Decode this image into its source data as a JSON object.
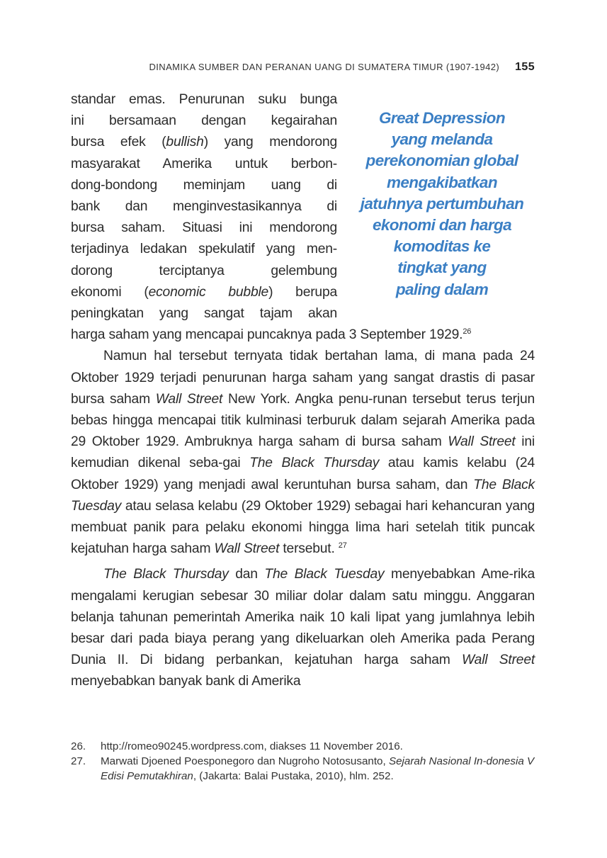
{
  "header": {
    "running_title": "DINAMIKA SUMBER DAN PERANAN UANG DI SUMATERA TIMUR (1907-1942)",
    "page_number": "155"
  },
  "pullquote": [
    "Great Depression",
    "yang melanda",
    "perekonomian global",
    "mengakibatkan",
    "jatuhnya pertumbuhan",
    "ekonomi dan harga",
    "komoditas ke",
    "tingkat yang",
    "paling dalam"
  ],
  "para1": {
    "l1": "standar emas. Penurunan suku bunga",
    "l2": "ini bersamaan dengan kegairahan",
    "l3a": "bursa efek (",
    "l3b": "bullish",
    "l3c": ") yang mendorong",
    "l4": "masyarakat Amerika untuk berbon-",
    "l5": "dong-bondong meminjam uang di",
    "l6": "bank dan menginvestasikannya di",
    "l7": "bursa saham. Situasi ini mendorong",
    "l8": "terjadinya ledakan spekulatif yang men-",
    "l9": "dorong terciptanya gelembung",
    "l10a": "ekonomi (",
    "l10b": "economic bubble",
    "l10c": ") berupa",
    "l11": "peningkatan yang sangat tajam akan",
    "l12": "harga saham yang mencapai puncaknya pada 3 September 1929.",
    "ref": "26"
  },
  "para2": {
    "t1": "Namun hal tersebut ternyata tidak bertahan lama, di mana pada 24 Oktober 1929 terjadi penurunan harga saham yang sangat drastis di pasar bursa saham ",
    "e1": "Wall Street",
    "t2": " New York. Angka penu-runan tersebut terus terjun bebas hingga mencapai titik kulminasi terburuk dalam sejarah Amerika pada 29 Oktober 1929. Ambruknya harga saham di bursa saham ",
    "e2": "Wall Street",
    "t3": " ini kemudian dikenal seba-gai ",
    "e3": "The Black Thursday",
    "t4": " atau kamis kelabu (24 Oktober 1929) yang menjadi awal keruntuhan bursa saham, dan ",
    "e4": "The Black Tuesday",
    "t5": " atau selasa kelabu (29 Oktober 1929) sebagai hari kehancuran yang membuat panik para pelaku ekonomi hingga lima hari setelah titik puncak kejatuhan harga saham ",
    "e5": "Wall Street",
    "t6": " tersebut. ",
    "ref": "27"
  },
  "para3": {
    "e1": "The Black Thursday",
    "t1": " dan ",
    "e2": "The Black Tuesday",
    "t2": " menyebabkan Ame-rika mengalami kerugian sebesar 30 miliar dolar dalam satu minggu. Anggaran belanja tahunan pemerintah Amerika naik 10 kali lipat yang jumlahnya lebih besar dari pada biaya perang yang dikeluarkan oleh Amerika pada Perang Dunia II. Di bidang perbankan, kejatuhan harga saham ",
    "e3": "Wall Street",
    "t3": " menyebabkan banyak bank di Amerika"
  },
  "footnotes": [
    {
      "num": "26.",
      "text": "http://romeo90245.wordpress.com, diakses 11 November 2016."
    },
    {
      "num": "27.",
      "pre": "Marwati Djoened Poesponegoro dan Nugroho Notosusanto, ",
      "title": "Sejarah Nasional In-donesia V Edisi Pemutakhiran",
      "post": ", (Jakarta: Balai Pustaka, 2010), hlm. 252."
    }
  ],
  "colors": {
    "pullquote": "#3b7fc4",
    "text": "#2b2b2b"
  }
}
